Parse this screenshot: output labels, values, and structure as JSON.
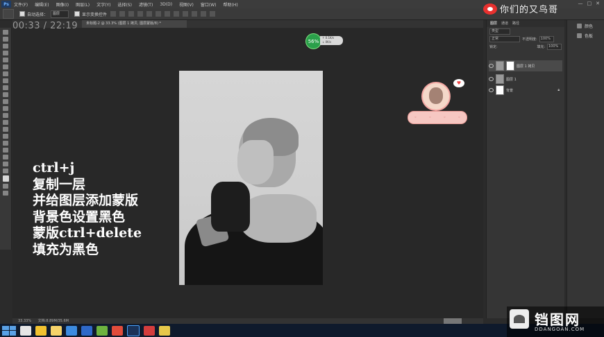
{
  "app": {
    "logo": "Ps"
  },
  "menu": {
    "items": [
      "文件(F)",
      "编辑(E)",
      "图像(I)",
      "图层(L)",
      "文字(Y)",
      "选择(S)",
      "滤镜(T)",
      "3D(D)",
      "视图(V)",
      "窗口(W)",
      "帮助(H)"
    ]
  },
  "window_controls": {
    "minimize": "—",
    "maximize": "□",
    "close": "✕"
  },
  "options_bar": {
    "auto_select_label": "自动选择：",
    "auto_select_value": "图层",
    "show_transform_label": "显示变换控件"
  },
  "recording_timer": "00:33 / 22:19",
  "document_tab": "未标题-2 @ 33.3% (图层 1 拷贝, 图层蒙版/8) *",
  "network_indicator": {
    "percent": "56%",
    "up": "↑ 0.1K/s",
    "down": "↓ 0K/s"
  },
  "watermark_top": "你们的又鸟哥",
  "caption": {
    "lines": [
      "ctrl+j",
      "复制一层",
      "并给图层添加蒙版",
      "背景色设置黑色",
      "蒙版ctrl+delete",
      "填充为黑色"
    ]
  },
  "layers_panel": {
    "tabs": [
      "图层",
      "通道",
      "路径"
    ],
    "kind_label": "类型",
    "blend_mode": "正常",
    "opacity_label": "不透明度:",
    "opacity_value": "100%",
    "lock_label": "锁定:",
    "fill_label": "填充:",
    "fill_value": "100%",
    "layers": [
      {
        "name": "图层 1 拷贝"
      },
      {
        "name": "图层 1"
      },
      {
        "name": "背景"
      }
    ]
  },
  "side_panel": {
    "items": [
      "颜色",
      "色板"
    ]
  },
  "status_bar": {
    "zoom": "33.33%",
    "doc": "文档:8.89M/35.6M"
  },
  "watermark_bottom": {
    "title": "铛图网",
    "url": "DDANGOAN.COM"
  },
  "colors": {
    "accent_red": "#e8312f",
    "panel_bg": "#353535",
    "canvas_bg": "#282828"
  }
}
